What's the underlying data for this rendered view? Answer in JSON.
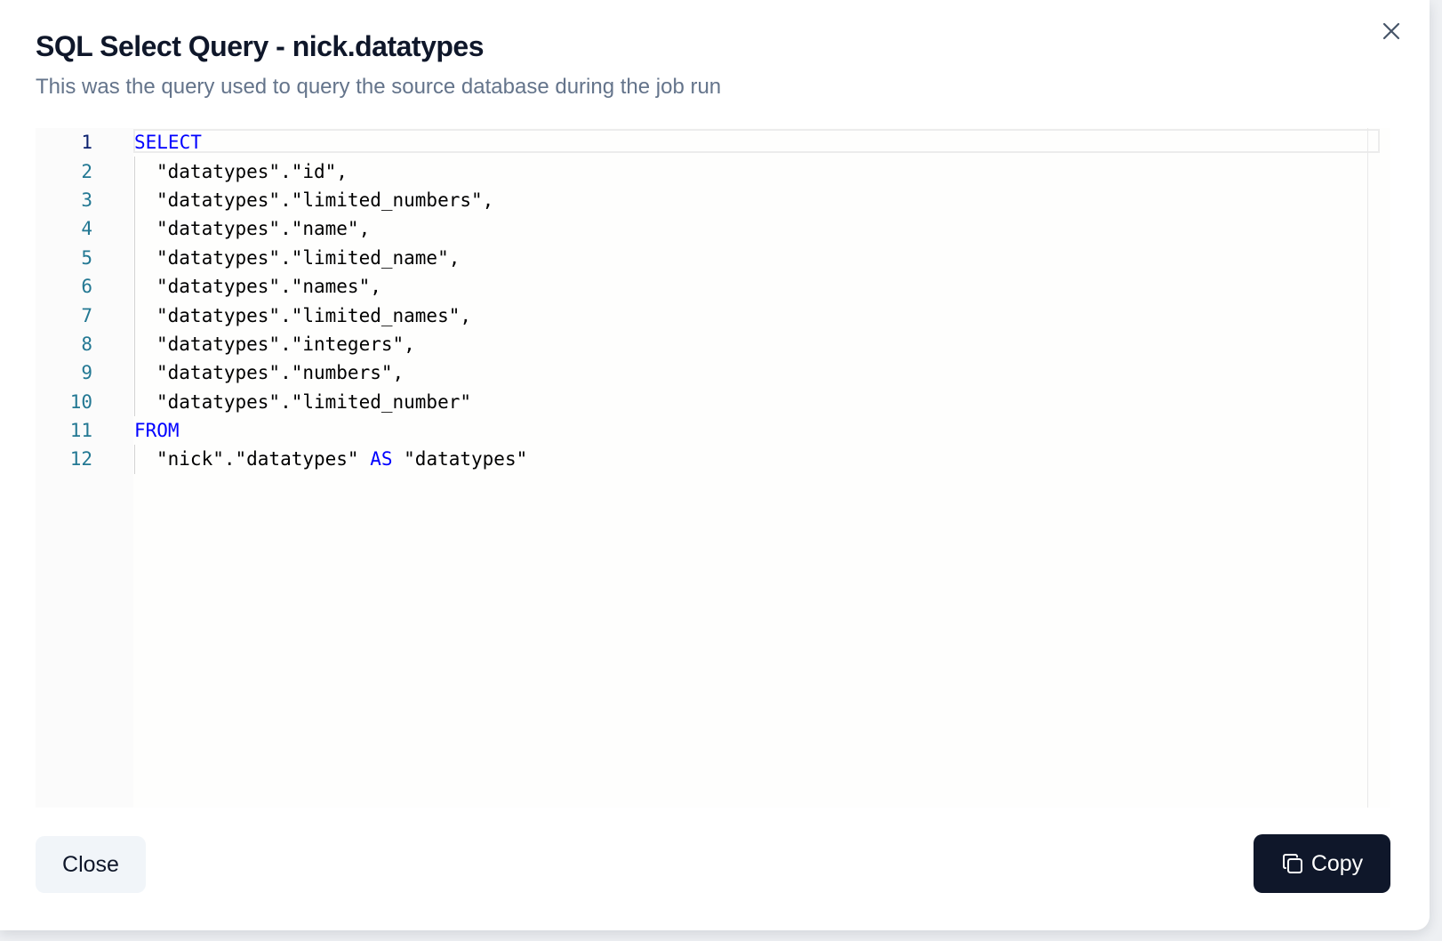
{
  "dialog": {
    "title": "SQL Select Query - nick.datatypes",
    "subtitle": "This was the query used to query the source database during the job run"
  },
  "editor": {
    "lines": [
      {
        "number": "1",
        "tokens": [
          {
            "text": "SELECT",
            "kind": "keyword"
          }
        ]
      },
      {
        "number": "2",
        "tokens": [
          {
            "text": "\"datatypes\".\"id\",",
            "kind": "text"
          }
        ]
      },
      {
        "number": "3",
        "tokens": [
          {
            "text": "\"datatypes\".\"limited_numbers\",",
            "kind": "text"
          }
        ]
      },
      {
        "number": "4",
        "tokens": [
          {
            "text": "\"datatypes\".\"name\",",
            "kind": "text"
          }
        ]
      },
      {
        "number": "5",
        "tokens": [
          {
            "text": "\"datatypes\".\"limited_name\",",
            "kind": "text"
          }
        ]
      },
      {
        "number": "6",
        "tokens": [
          {
            "text": "\"datatypes\".\"names\",",
            "kind": "text"
          }
        ]
      },
      {
        "number": "7",
        "tokens": [
          {
            "text": "\"datatypes\".\"limited_names\",",
            "kind": "text"
          }
        ]
      },
      {
        "number": "8",
        "tokens": [
          {
            "text": "\"datatypes\".\"integers\",",
            "kind": "text"
          }
        ]
      },
      {
        "number": "9",
        "tokens": [
          {
            "text": "\"datatypes\".\"numbers\",",
            "kind": "text"
          }
        ]
      },
      {
        "number": "10",
        "tokens": [
          {
            "text": "\"datatypes\".\"limited_number\"",
            "kind": "text"
          }
        ]
      },
      {
        "number": "11",
        "tokens": [
          {
            "text": "FROM",
            "kind": "keyword"
          }
        ]
      },
      {
        "number": "12",
        "tokens": [
          {
            "text": "\"nick\".\"datatypes\" ",
            "kind": "text"
          },
          {
            "text": "AS",
            "kind": "keyword"
          },
          {
            "text": " \"datatypes\"",
            "kind": "text"
          }
        ]
      }
    ],
    "active_line": "1"
  },
  "footer": {
    "close_label": "Close",
    "copy_label": "Copy"
  },
  "icons": {
    "close": "x-icon",
    "copy": "copy-icon"
  },
  "colors": {
    "keyword": "#0000ff",
    "line_number": "#237893",
    "primary_button": "#0f172a",
    "secondary_button": "#f1f5f9"
  }
}
